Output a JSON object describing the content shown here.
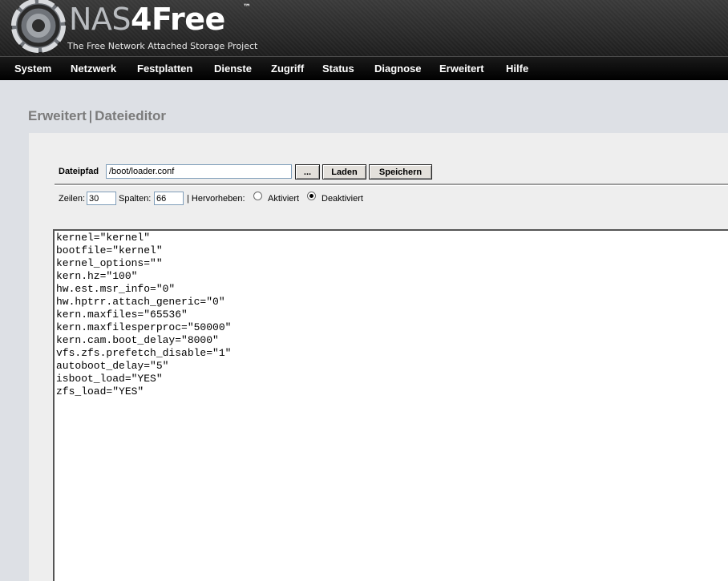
{
  "header": {
    "logo_nas": "NAS",
    "logo_free": "4Free",
    "logo_tm": "™",
    "tagline": "The Free Network Attached Storage Project"
  },
  "menu": [
    {
      "label": "System"
    },
    {
      "label": "Netzwerk"
    },
    {
      "label": "Festplatten"
    },
    {
      "label": "Dienste"
    },
    {
      "label": "Zugriff"
    },
    {
      "label": "Status"
    },
    {
      "label": "Diagnose"
    },
    {
      "label": "Erweitert"
    },
    {
      "label": "Hilfe"
    }
  ],
  "title": {
    "section": "Erweitert",
    "separator": "|",
    "page": "Dateieditor"
  },
  "toolbar": {
    "path_label": "Dateipfad",
    "path_value": "/boot/loader.conf",
    "browse_label": "...",
    "load_label": "Laden",
    "save_label": "Speichern"
  },
  "options": {
    "rows_label": "Zeilen:",
    "rows_value": "30",
    "cols_label": "Spalten:",
    "cols_value": "66",
    "highlight_label": "| Hervorheben:",
    "enabled_label": "Aktiviert",
    "disabled_label": "Deaktiviert",
    "highlight_selected": "Deaktiviert"
  },
  "editor": {
    "lines": [
      "kernel=\"kernel\"",
      "bootfile=\"kernel\"",
      "kernel_options=\"\"",
      "kern.hz=\"100\"",
      "hw.est.msr_info=\"0\"",
      "hw.hptrr.attach_generic=\"0\"",
      "kern.maxfiles=\"65536\"",
      "kern.maxfilesperproc=\"50000\"",
      "kern.cam.boot_delay=\"8000\"",
      "vfs.zfs.prefetch_disable=\"1\"",
      "autoboot_delay=\"5\"",
      "isboot_load=\"YES\"",
      "zfs_load=\"YES\""
    ]
  },
  "colors": {
    "page_bg": "#dde0e5",
    "panel_bg": "#eeeeee",
    "menubar_bg": "#000000",
    "title_text": "#7b7b7b"
  }
}
